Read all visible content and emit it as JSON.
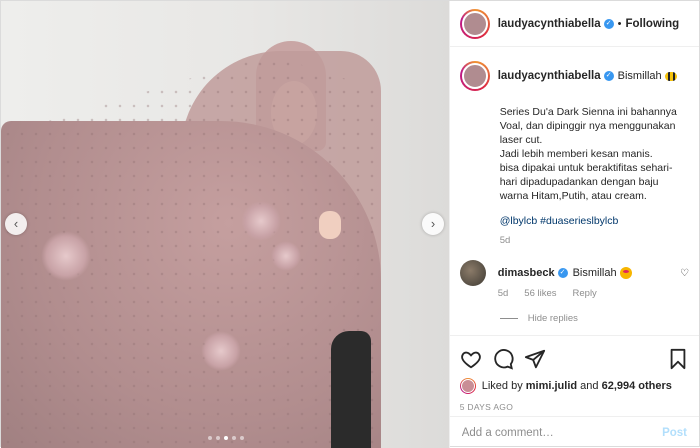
{
  "header": {
    "username": "laudyacynthiabella",
    "separator": "•",
    "follow_label": "Following"
  },
  "caption": {
    "username": "laudyacynthiabella",
    "first_line": "Bismillah",
    "text": "Series Du'a Dark Sienna ini bahannya Voal, dan dipinggir nya menggunakan laser cut.\nJadi lebih memberi kesan manis.\nbisa dipakai untuk beraktifitas sehari-hari dipadupadankan dengan baju warna Hitam,Putih, atau cream.",
    "hashtags": "@lbylcb #duaserieslbylcb",
    "time": "5d"
  },
  "comment": {
    "username": "dimasbeck",
    "text": "Bismillah",
    "time": "5d",
    "likes": "56 likes",
    "reply": "Reply"
  },
  "hide_replies": "Hide replies",
  "media": {
    "dot_count": 5,
    "active_dot": 3,
    "prev_symbol": "‹",
    "next_symbol": "›"
  },
  "likes": {
    "prefix": "Liked by",
    "user": "mimi.julid",
    "and": "and",
    "others": "62,994 others"
  },
  "date": "5 DAYS AGO",
  "add_comment": {
    "placeholder": "Add a comment…",
    "post_label": "Post"
  },
  "icons": {
    "like": "heart-icon",
    "comment": "comment-icon",
    "share": "share-icon",
    "save": "bookmark-icon"
  }
}
